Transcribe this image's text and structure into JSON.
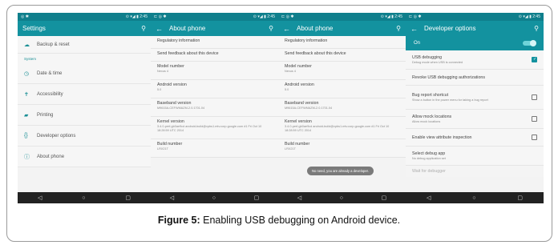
{
  "status": {
    "left_icons": "◎ ✱",
    "right_icons": "⊙ ▾◢ ▮ 2:45",
    "alt_left": "⊏ ◎ ✱"
  },
  "panel1": {
    "title": "Settings",
    "items_top": [
      {
        "icon": "☁",
        "label": "Backup & reset"
      }
    ],
    "section": "System",
    "items": [
      {
        "icon": "◷",
        "label": "Date & time"
      },
      {
        "icon": "✝",
        "label": "Accessibility"
      },
      {
        "icon": "▰",
        "label": "Printing"
      },
      {
        "icon": "{}",
        "label": "Developer options"
      },
      {
        "icon": "ⓘ",
        "label": "About phone"
      }
    ]
  },
  "about": {
    "title": "About phone",
    "rows": [
      {
        "t": "Regulatory information",
        "s": ""
      },
      {
        "t": "Send feedback about this device",
        "s": ""
      },
      {
        "t": "Model number",
        "s": "Nexus 4"
      },
      {
        "t": "Android version",
        "s": "5.0"
      },
      {
        "t": "Baseband version",
        "s": "M9615A-CEFWMAZM-2.0.1701.04"
      },
      {
        "t": "Kernel version",
        "s": "3.4.0-perf-gb0ae9cd android-build@vpbs1.mtv.corp.google.com #1 Fri Oct 10 18:28:59 UTC 2014"
      },
      {
        "t": "Build number",
        "s": "LRX21T"
      }
    ],
    "toast": "No need, you are already a developer."
  },
  "dev": {
    "title": "Developer options",
    "on_label": "On",
    "rows": [
      {
        "t": "USB debugging",
        "s": "Debug mode when USB is connected",
        "check": "on"
      },
      {
        "t": "Revoke USB debugging authorizations",
        "s": "",
        "check": ""
      },
      {
        "t": "Bug report shortcut",
        "s": "Show a button in the power menu for taking a bug report",
        "check": "off"
      },
      {
        "t": "Allow mock locations",
        "s": "Allow mock locations",
        "check": "off"
      },
      {
        "t": "Enable view attribute inspection",
        "s": "",
        "check": "off"
      },
      {
        "t": "Select debug app",
        "s": "No debug application set",
        "check": ""
      },
      {
        "t": "Wait for debugger",
        "s": "",
        "check": ""
      }
    ]
  },
  "nav": {
    "back": "◁",
    "home": "○",
    "recent": "▢"
  },
  "caption": {
    "bold": "Figure 5:",
    "text": " Enabling USB debugging on Android device."
  }
}
